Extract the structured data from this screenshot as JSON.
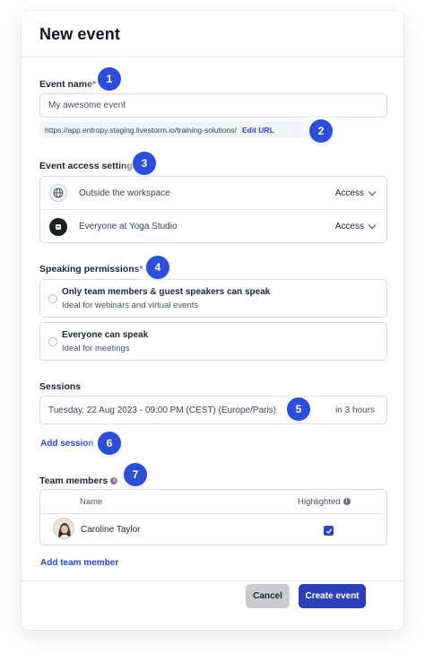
{
  "modal": {
    "title": "New event"
  },
  "event_name": {
    "label": "Event name*",
    "value": "My awesome event"
  },
  "url": {
    "text": "https://app.entropy.staging.livestorm.io/training-solutions/",
    "edit_label": "Edit URL"
  },
  "access": {
    "label": "Event access settings",
    "rows": [
      {
        "name": "Outside the workspace",
        "access_label": "Access",
        "icon": "globe-icon"
      },
      {
        "name": "Everyone at Yoga Studio",
        "access_label": "Access",
        "icon": "organization-icon"
      }
    ]
  },
  "speaking": {
    "label": "Speaking permissions*",
    "options": [
      {
        "title": "Only team members & guest speakers can speak",
        "subtitle": "Ideal for webinars and virtual events"
      },
      {
        "title": "Everyone can speak",
        "subtitle": "Ideal for meetings"
      }
    ]
  },
  "sessions": {
    "label": "Sessions",
    "date": "Tuesday, 22 Aug 2023 - 09:00 PM (CEST) (Europe/Paris)",
    "relative": "in 3 hours",
    "add_label": "Add session"
  },
  "team": {
    "label": "Team members",
    "col_name": "Name",
    "col_highlighted": "Highlighted",
    "members": [
      {
        "name": "Caroline Taylor",
        "highlighted": true
      }
    ],
    "add_label": "Add team member"
  },
  "footer": {
    "cancel_label": "Cancel",
    "create_label": "Create event"
  },
  "badges": [
    "1",
    "2",
    "3",
    "4",
    "5",
    "6",
    "7"
  ],
  "colors": {
    "accent": "#2d46c8",
    "badge": "#2d4fd6",
    "primary_button": "#2a3fb8",
    "cancel_button": "#c9cbcf"
  }
}
